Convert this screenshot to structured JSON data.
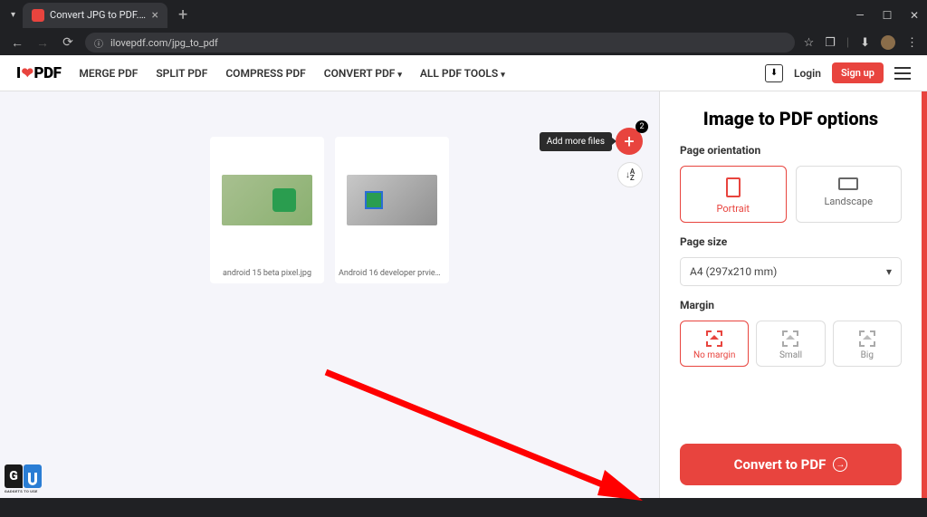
{
  "browser": {
    "tab_title": "Convert JPG to PDF. Images JP...",
    "url": "ilovepdf.com/jpg_to_pdf"
  },
  "header": {
    "logo_left": "I",
    "logo_right": "PDF",
    "nav": {
      "merge": "MERGE PDF",
      "split": "SPLIT PDF",
      "compress": "COMPRESS PDF",
      "convert": "CONVERT PDF",
      "all_tools": "ALL PDF TOOLS"
    },
    "login": "Login",
    "signup": "Sign up"
  },
  "canvas": {
    "add_tooltip": "Add more files",
    "add_count": "2",
    "sort_label": "A\nZ",
    "files": [
      {
        "label": "android 15 beta pixel.jpg"
      },
      {
        "label": "Android 16 developer prview.j..."
      }
    ]
  },
  "panel": {
    "title": "Image to PDF options",
    "orientation": {
      "label": "Page orientation",
      "portrait": "Portrait",
      "landscape": "Landscape"
    },
    "page_size": {
      "label": "Page size",
      "value": "A4 (297x210 mm)"
    },
    "margin": {
      "label": "Margin",
      "none": "No margin",
      "small": "Small",
      "big": "Big"
    },
    "convert": "Convert to PDF"
  },
  "watermark": "GADGETS TO USE"
}
